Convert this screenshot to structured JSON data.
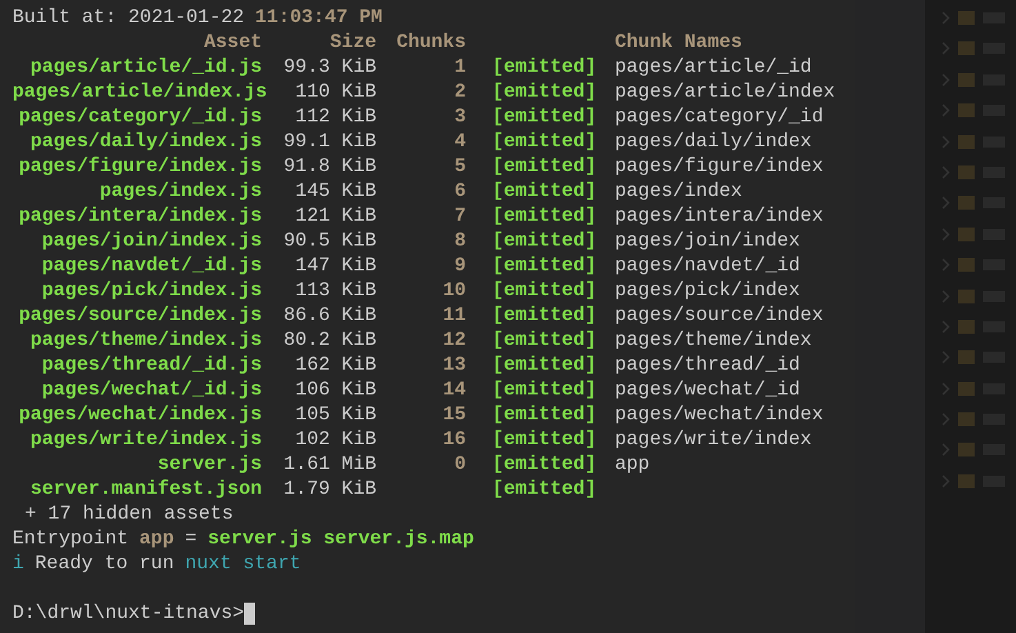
{
  "built_line": {
    "label": "Built at: 2021-01-22",
    "value": "11:03:47 PM"
  },
  "table": {
    "columns": [
      "Asset",
      "Size",
      "Chunks",
      "Chunk Names"
    ],
    "rows": [
      {
        "asset": "pages/article/_id.js",
        "size": "99.3 KiB",
        "chunks": "1",
        "status": "[emitted]",
        "chunk_names": "pages/article/_id"
      },
      {
        "asset": "pages/article/index.js",
        "size": "110 KiB",
        "chunks": "2",
        "status": "[emitted]",
        "chunk_names": "pages/article/index"
      },
      {
        "asset": "pages/category/_id.js",
        "size": "112 KiB",
        "chunks": "3",
        "status": "[emitted]",
        "chunk_names": "pages/category/_id"
      },
      {
        "asset": "pages/daily/index.js",
        "size": "99.1 KiB",
        "chunks": "4",
        "status": "[emitted]",
        "chunk_names": "pages/daily/index"
      },
      {
        "asset": "pages/figure/index.js",
        "size": "91.8 KiB",
        "chunks": "5",
        "status": "[emitted]",
        "chunk_names": "pages/figure/index"
      },
      {
        "asset": "pages/index.js",
        "size": "145 KiB",
        "chunks": "6",
        "status": "[emitted]",
        "chunk_names": "pages/index"
      },
      {
        "asset": "pages/intera/index.js",
        "size": "121 KiB",
        "chunks": "7",
        "status": "[emitted]",
        "chunk_names": "pages/intera/index"
      },
      {
        "asset": "pages/join/index.js",
        "size": "90.5 KiB",
        "chunks": "8",
        "status": "[emitted]",
        "chunk_names": "pages/join/index"
      },
      {
        "asset": "pages/navdet/_id.js",
        "size": "147 KiB",
        "chunks": "9",
        "status": "[emitted]",
        "chunk_names": "pages/navdet/_id"
      },
      {
        "asset": "pages/pick/index.js",
        "size": "113 KiB",
        "chunks": "10",
        "status": "[emitted]",
        "chunk_names": "pages/pick/index"
      },
      {
        "asset": "pages/source/index.js",
        "size": "86.6 KiB",
        "chunks": "11",
        "status": "[emitted]",
        "chunk_names": "pages/source/index"
      },
      {
        "asset": "pages/theme/index.js",
        "size": "80.2 KiB",
        "chunks": "12",
        "status": "[emitted]",
        "chunk_names": "pages/theme/index"
      },
      {
        "asset": "pages/thread/_id.js",
        "size": "162 KiB",
        "chunks": "13",
        "status": "[emitted]",
        "chunk_names": "pages/thread/_id"
      },
      {
        "asset": "pages/wechat/_id.js",
        "size": "106 KiB",
        "chunks": "14",
        "status": "[emitted]",
        "chunk_names": "pages/wechat/_id"
      },
      {
        "asset": "pages/wechat/index.js",
        "size": "105 KiB",
        "chunks": "15",
        "status": "[emitted]",
        "chunk_names": "pages/wechat/index"
      },
      {
        "asset": "pages/write/index.js",
        "size": "102 KiB",
        "chunks": "16",
        "status": "[emitted]",
        "chunk_names": "pages/write/index"
      },
      {
        "asset": "server.js",
        "size": "1.61 MiB",
        "chunks": "0",
        "status": "[emitted]",
        "chunk_names": "app"
      },
      {
        "asset": "server.manifest.json",
        "size": "1.79 KiB",
        "chunks": "",
        "status": "[emitted]",
        "chunk_names": ""
      }
    ]
  },
  "hidden_assets": "+ 17 hidden assets",
  "entrypoint": {
    "label": "Entrypoint",
    "name": "app",
    "equals": "=",
    "files": "server.js server.js.map"
  },
  "ready": {
    "icon": "i",
    "text": "Ready to run",
    "command": "nuxt start"
  },
  "prompt": "D:\\drwl\\nuxt-itnavs>"
}
